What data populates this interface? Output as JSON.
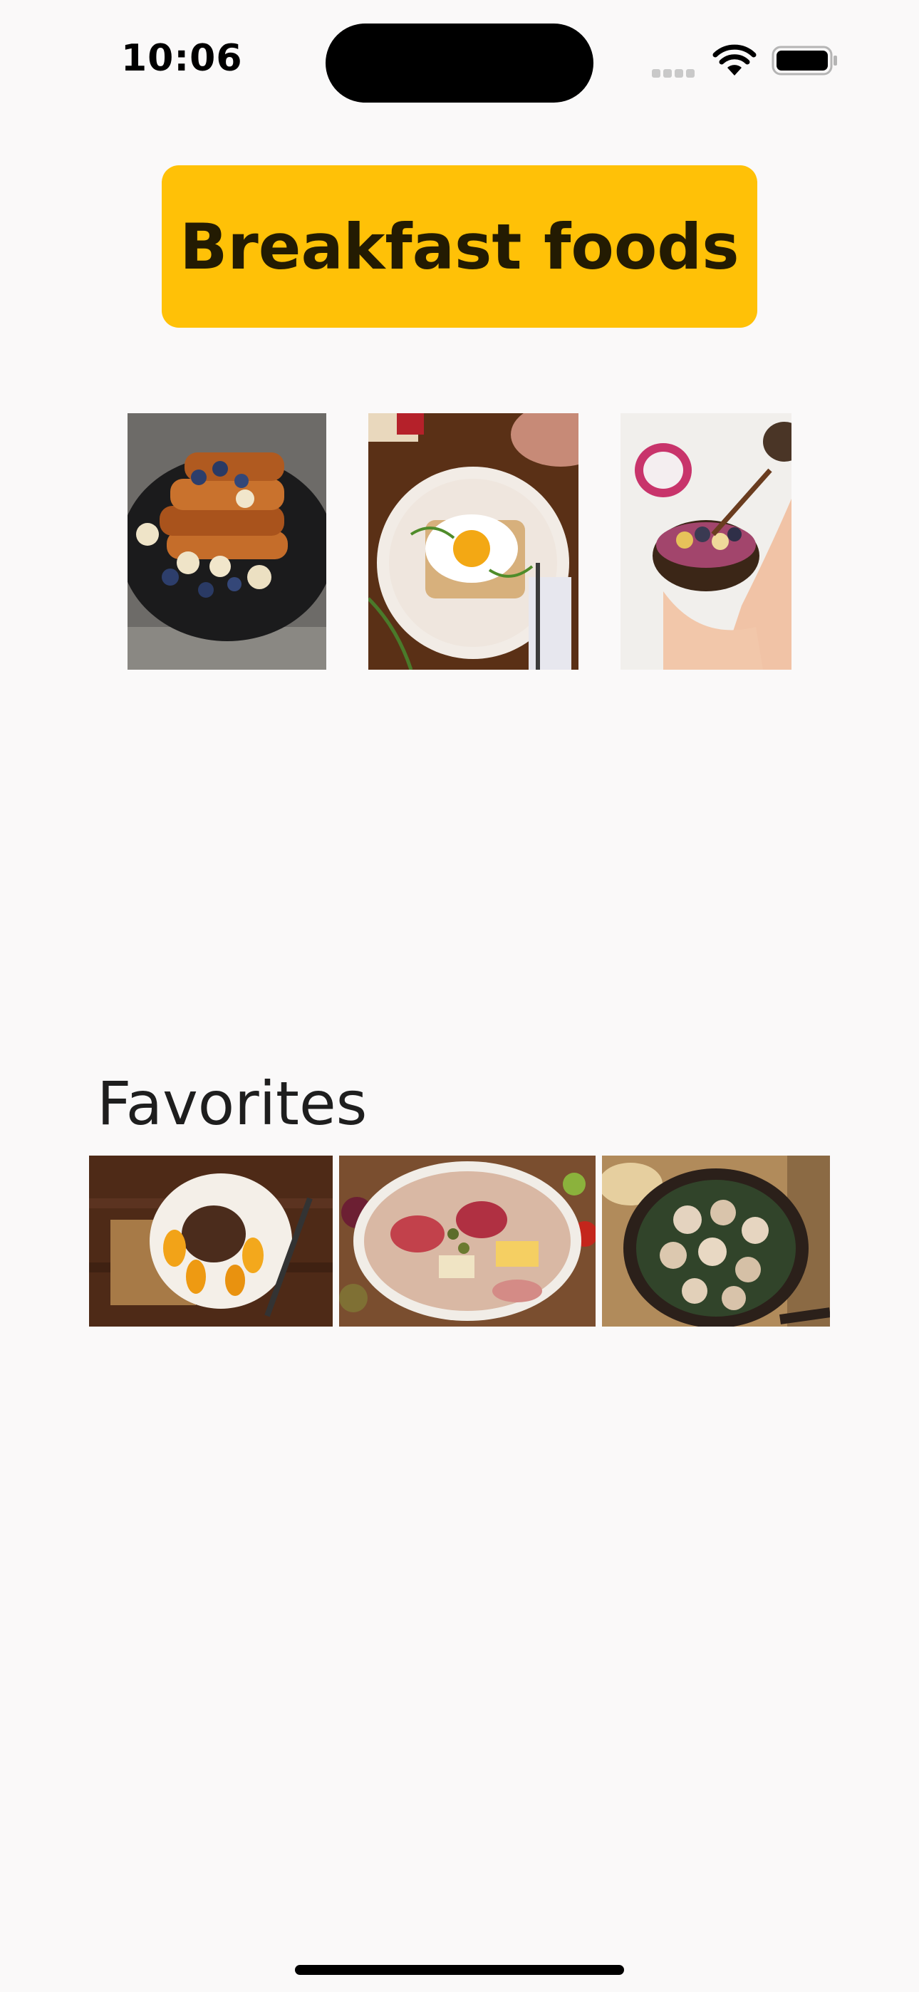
{
  "status_bar": {
    "time": "10:06",
    "icons": [
      "signal-icon",
      "wifi-icon",
      "battery-icon"
    ]
  },
  "header": {
    "button_label": "Breakfast foods",
    "button_color": "#ffc107"
  },
  "breakfast_images": [
    {
      "name": "french-toast-image"
    },
    {
      "name": "fried-egg-toast-image"
    },
    {
      "name": "smoothie-bowl-image"
    }
  ],
  "favorites": {
    "heading": "Favorites",
    "images": [
      {
        "name": "steak-plate-image"
      },
      {
        "name": "charcuterie-platter-image"
      },
      {
        "name": "escargot-pan-image"
      }
    ]
  }
}
